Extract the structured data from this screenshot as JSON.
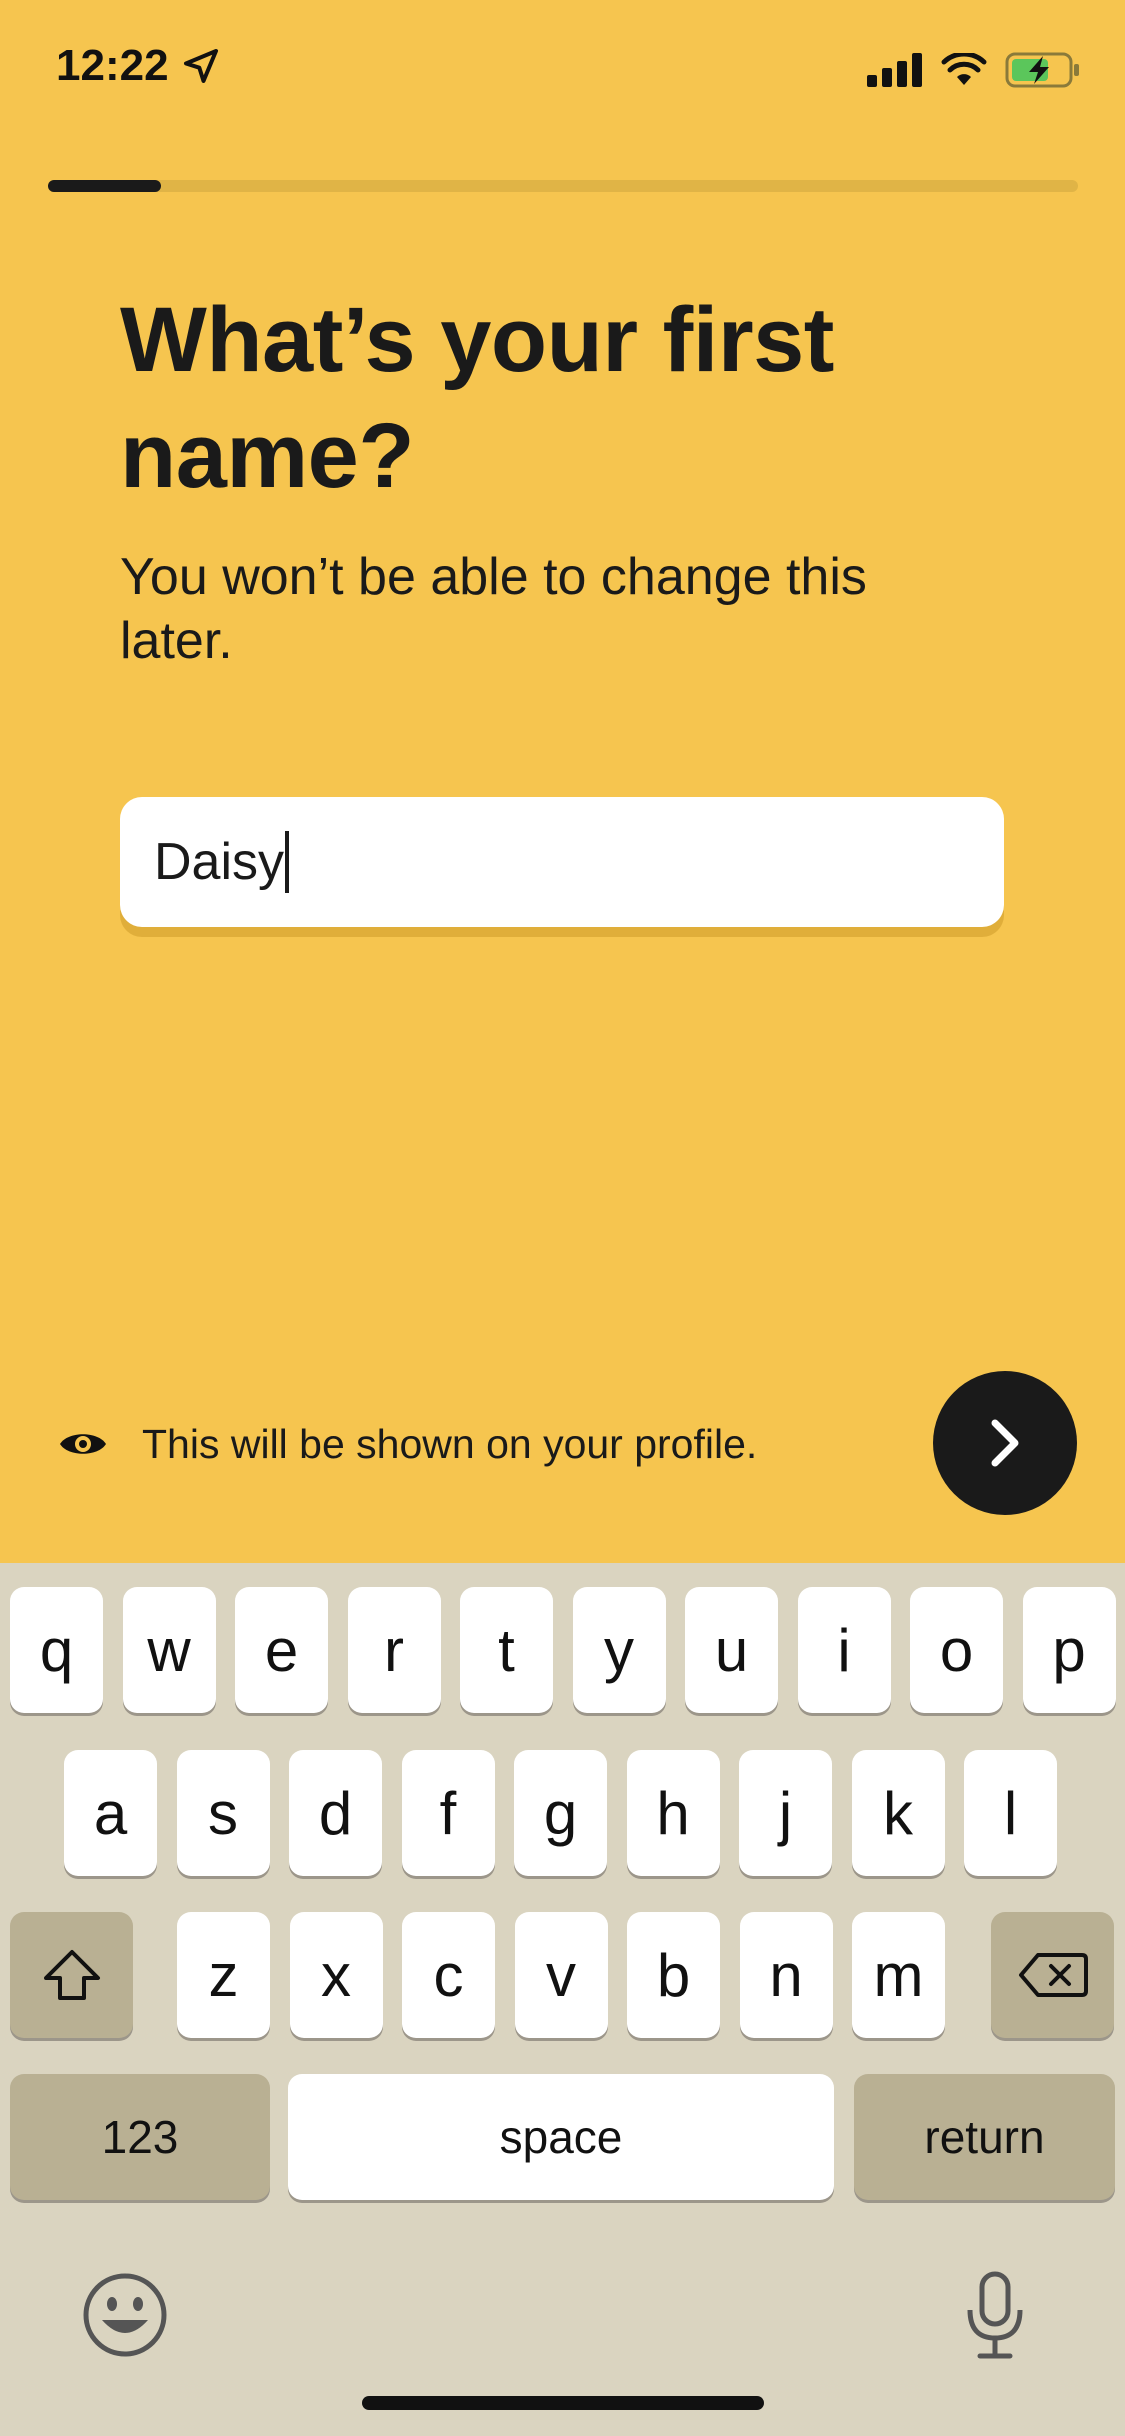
{
  "status_bar": {
    "time": "12:22",
    "icons": [
      "location-arrow-icon",
      "cellular-signal-icon",
      "wifi-icon",
      "battery-charging-icon"
    ]
  },
  "progress": {
    "fraction": 0.11
  },
  "title": "What’s your first name?",
  "subtitle": "You won’t be able to change this later.",
  "name_input": {
    "value": "Daisy"
  },
  "hint": {
    "icon": "eye-icon",
    "text": "This will be shown on your profile."
  },
  "next_button": {
    "icon": "chevron-right-icon"
  },
  "colors": {
    "background": "#F6C54F",
    "text": "#1A1A1A",
    "keyboard_bg": "#DAD4C0",
    "key_dark": "#B9B093",
    "key_light": "#FFFFFF"
  },
  "keyboard": {
    "row1": [
      "q",
      "w",
      "e",
      "r",
      "t",
      "y",
      "u",
      "i",
      "o",
      "p"
    ],
    "row2": [
      "a",
      "s",
      "d",
      "f",
      "g",
      "h",
      "j",
      "k",
      "l"
    ],
    "row3": [
      "z",
      "x",
      "c",
      "v",
      "b",
      "n",
      "m"
    ],
    "numbers_label": "123",
    "space_label": "space",
    "return_label": "return",
    "icons": [
      "shift-icon",
      "backspace-icon",
      "emoji-icon",
      "microphone-icon"
    ]
  }
}
